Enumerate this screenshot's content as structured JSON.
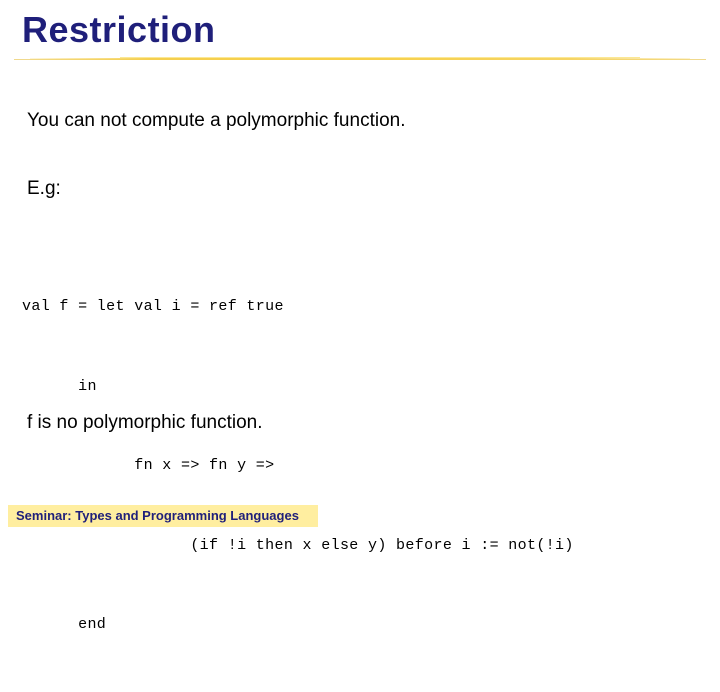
{
  "slide": {
    "title": "Restriction",
    "title_color": "#1f1f7a",
    "background_color": "#ffffff",
    "divider_color": "#f7d04a"
  },
  "body": {
    "statement": "You can not compute a polymorphic function.",
    "example_label": "E.g:",
    "conclusion": "f is no polymorphic function."
  },
  "code": {
    "language": "sml",
    "lines": [
      "val f = let val i = ref true",
      "      in",
      "            fn x => fn y =>",
      "                  (if !i then x else y) before i := not(!i)",
      "      end"
    ]
  },
  "footer": {
    "label": "Seminar: Types and Programming Languages",
    "background_color": "#ffeea0",
    "text_color": "#1f1f7a"
  }
}
